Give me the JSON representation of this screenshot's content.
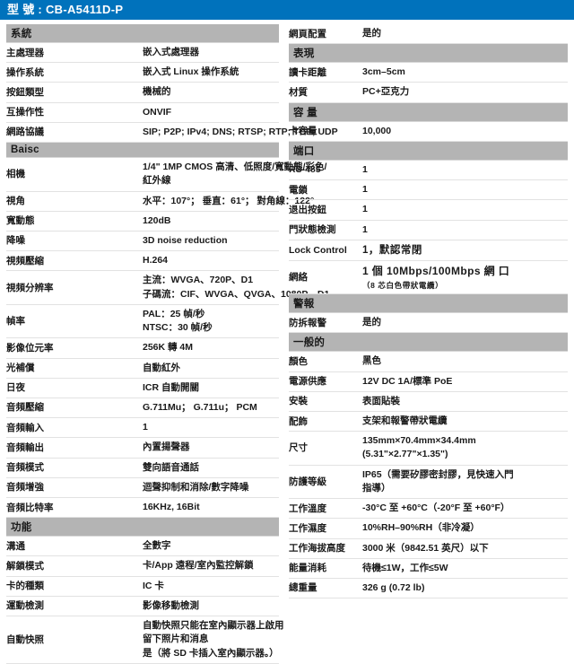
{
  "header": {
    "label": "型 號 :",
    "model": "CB-A5411D-P",
    "full": "型 號 : CB-A5411D-P",
    "bg_color": "#0072bc",
    "text_color": "#ffffff"
  },
  "colors": {
    "section_band": "#b4b4b4",
    "row_divider": "#e2e2e2",
    "text": "#1a1a1a",
    "accent_blue": "#0072bc"
  },
  "left_column": [
    {
      "type": "section",
      "title": "系統"
    },
    {
      "type": "row",
      "key": "主處理器",
      "value": [
        "嵌入式處理器"
      ]
    },
    {
      "type": "row",
      "key": "操作系統",
      "value": [
        "嵌入式 Linux 操作系統"
      ]
    },
    {
      "type": "row",
      "key": "按鈕類型",
      "value": [
        "機械的"
      ]
    },
    {
      "type": "row",
      "key": "互操作性",
      "value": [
        "ONVIF"
      ]
    },
    {
      "type": "row",
      "key": "網路協議",
      "value": [
        "SIP; P2P; IPv4; DNS; RTSP; RTP; TCP; UDP"
      ]
    },
    {
      "type": "section",
      "title": "Baisc"
    },
    {
      "type": "row",
      "key": "相機",
      "value": [
        "1/4\" 1MP CMOS  高清、低照度/寬動態/彩色/",
        "紅外線"
      ]
    },
    {
      "type": "row",
      "key": "視角",
      "value": [
        "水平：107°；  垂直：61°；  對角線：122°"
      ]
    },
    {
      "type": "row",
      "key": "寬動態",
      "value": [
        "120dB"
      ]
    },
    {
      "type": "row",
      "key": "降噪",
      "value": [
        "3D noise reduction"
      ]
    },
    {
      "type": "row",
      "key": "視頻壓縮",
      "value": [
        "H.264"
      ]
    },
    {
      "type": "row",
      "key": "視頻分辨率",
      "value": [
        "主流：WVGA、720P、D1",
        "子碼流：CIF、WVGA、QVGA、1080P、D1"
      ]
    },
    {
      "type": "row",
      "key": "幀率",
      "value": [
        "PAL：25  幀/秒",
        "NTSC：30  幀/秒"
      ]
    },
    {
      "type": "row",
      "key": "影像位元率",
      "value": [
        "256K 轉 4M"
      ]
    },
    {
      "type": "row",
      "key": "光補償",
      "value": [
        "自動紅外"
      ]
    },
    {
      "type": "row",
      "key": "日夜",
      "value": [
        "ICR 自動開關"
      ]
    },
    {
      "type": "row",
      "key": "音頻壓縮",
      "value": [
        "G.711Mu；  G.711u；  PCM"
      ]
    },
    {
      "type": "row",
      "key": "音頻輸入",
      "value": [
        "1"
      ]
    },
    {
      "type": "row",
      "key": "音頻輸出",
      "value": [
        "內置揚聲器"
      ]
    },
    {
      "type": "row",
      "key": "音頻模式",
      "value": [
        "雙向語音通話"
      ]
    },
    {
      "type": "row",
      "key": "音頻增強",
      "value": [
        "迴聲抑制和消除/數字降噪"
      ]
    },
    {
      "type": "row",
      "key": "音頻比特率",
      "value": [
        "16KHz, 16Bit"
      ]
    },
    {
      "type": "section",
      "title": "功能"
    },
    {
      "type": "row",
      "key": "溝通",
      "value": [
        "全數字"
      ]
    },
    {
      "type": "row",
      "key": "解鎖模式",
      "value": [
        "卡/App 遠程/室內監控解鎖"
      ]
    },
    {
      "type": "row",
      "key": "卡的種類",
      "value": [
        "IC 卡"
      ]
    },
    {
      "type": "row",
      "key": "運動檢測",
      "value": [
        "影像移動檢測"
      ]
    },
    {
      "type": "row",
      "key": "自動快照",
      "value": [
        "自動快照只能在室內顯示器上啟用",
        "留下照片和消息",
        "是（將 SD 卡插入室內顯示器。）"
      ]
    }
  ],
  "right_column": [
    {
      "type": "row",
      "key": "網頁配置",
      "value": [
        "是的"
      ]
    },
    {
      "type": "section",
      "title": "表現"
    },
    {
      "type": "row",
      "key": "讀卡距離",
      "value": [
        "3cm–5cm"
      ]
    },
    {
      "type": "row",
      "key": "材質",
      "value": [
        "PC+亞克力"
      ]
    },
    {
      "type": "section",
      "title": "容 量"
    },
    {
      "type": "row",
      "key": "卡容量",
      "value": [
        "10,000"
      ]
    },
    {
      "type": "section",
      "title": "端口"
    },
    {
      "type": "row",
      "key": "RS-485",
      "value": [
        "1"
      ]
    },
    {
      "type": "row",
      "key": "電鎖",
      "value": [
        "1"
      ]
    },
    {
      "type": "row",
      "key": "退出按鈕",
      "value": [
        "1"
      ]
    },
    {
      "type": "row",
      "key": "門狀態檢測",
      "value": [
        "1"
      ]
    },
    {
      "type": "row",
      "key": "Lock Control",
      "value": [
        "1，默認常閉"
      ],
      "style": "serifish"
    },
    {
      "type": "row",
      "key": "網絡",
      "value": [
        "1 個 10Mbps/100Mbps 網 口"
      ],
      "sub": "（8 芯白色帶狀電纜）",
      "style": "big"
    },
    {
      "type": "section",
      "title": "警報"
    },
    {
      "type": "row",
      "key": "防拆報警",
      "value": [
        "是的"
      ]
    },
    {
      "type": "section",
      "title": "一般的"
    },
    {
      "type": "row",
      "key": "顏色",
      "value": [
        "黑色"
      ]
    },
    {
      "type": "row",
      "key": "電源供應",
      "value": [
        "12V DC 1A/標準  PoE"
      ]
    },
    {
      "type": "row",
      "key": "安裝",
      "value": [
        "表面貼裝"
      ]
    },
    {
      "type": "row",
      "key": "配飾",
      "value": [
        "支架和報警帶狀電纜"
      ]
    },
    {
      "type": "row",
      "key": "尺寸",
      "value": [
        "135mm×70.4mm×34.4mm",
        "(5.31\"×2.77\"×1.35\")"
      ]
    },
    {
      "type": "row",
      "key": "防護等級",
      "value": [
        "IP65（需要矽膠密封膠，見快速入門",
        "指導）"
      ]
    },
    {
      "type": "row",
      "key": "工作溫度",
      "value": [
        "-30°C 至 +60°C（-20°F 至 +60°F）"
      ]
    },
    {
      "type": "row",
      "key": "工作濕度",
      "value": [
        "10%RH–90%RH（非冷凝）"
      ]
    },
    {
      "type": "row",
      "key": "工作海拔高度",
      "value": [
        "3000 米（9842.51 英尺）以下"
      ]
    },
    {
      "type": "row",
      "key": "能量消耗",
      "value": [
        "待機≤1W，工作≤5W"
      ]
    },
    {
      "type": "row",
      "key": "總重量",
      "value": [
        "326 g (0.72 lb)"
      ]
    }
  ]
}
